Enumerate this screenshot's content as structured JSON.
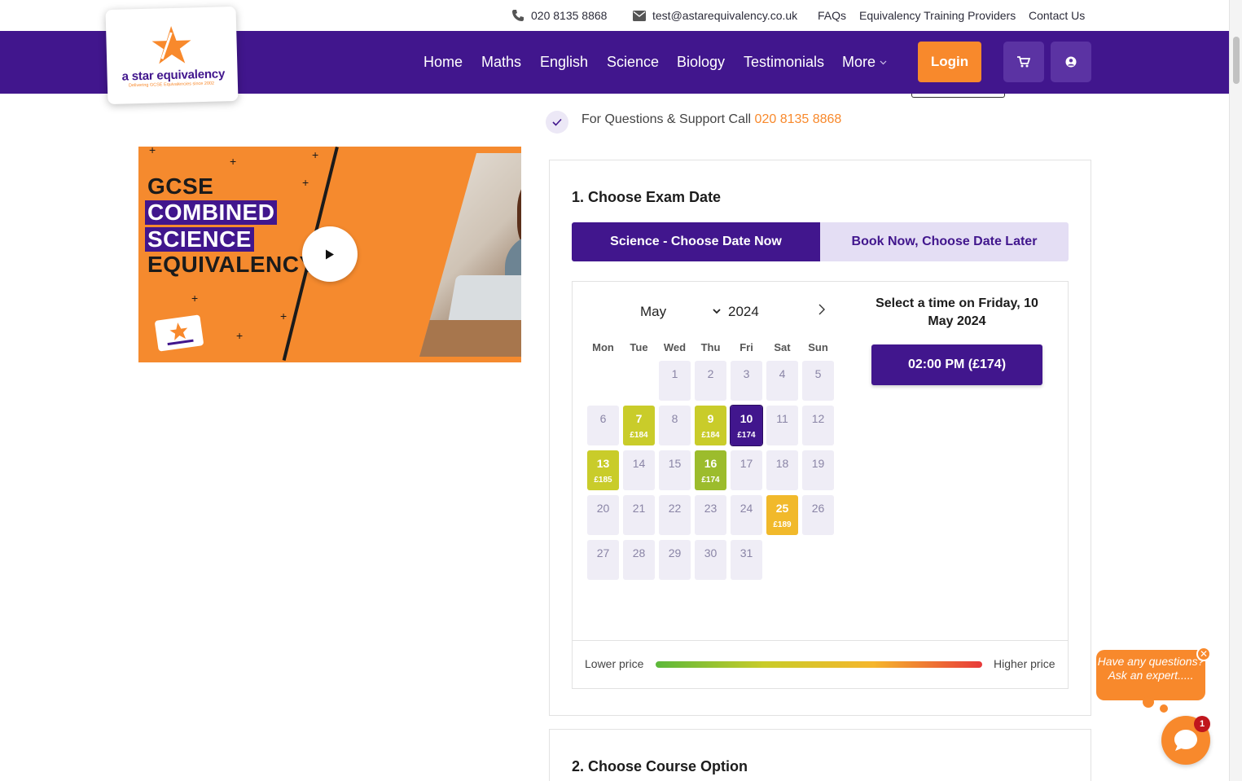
{
  "topbar": {
    "phone": "020 8135 8868",
    "email": "test@astarequivalency.co.uk",
    "links": [
      "FAQs",
      "Equivalency Training Providers",
      "Contact Us"
    ]
  },
  "brand": {
    "name": "a star equivalency",
    "tagline": "Delivering GCSE Equivalencies since 2002"
  },
  "nav": {
    "items": [
      "Home",
      "Maths",
      "English",
      "Science",
      "Biology",
      "Testimonials",
      "More"
    ],
    "login_label": "Login"
  },
  "support": {
    "text": "For Questions & Support Call ",
    "phone": "020 8135 8868"
  },
  "video": {
    "lines": [
      "GCSE",
      "COMBINED",
      "SCIENCE",
      "EQUIVALENCY"
    ]
  },
  "booking": {
    "step1_title": "1. Choose Exam Date",
    "tabs": [
      "Science - Choose Date Now",
      "Book Now, Choose Date Later"
    ],
    "calendar": {
      "month": "May",
      "year": "2024",
      "weekdays": [
        "Mon",
        "Tue",
        "Wed",
        "Thu",
        "Fri",
        "Sat",
        "Sun"
      ],
      "days": [
        {
          "d": "1",
          "col": 2,
          "row": 0
        },
        {
          "d": "2",
          "col": 3,
          "row": 0
        },
        {
          "d": "3",
          "col": 4,
          "row": 0
        },
        {
          "d": "4",
          "col": 5,
          "row": 0
        },
        {
          "d": "5",
          "col": 6,
          "row": 0
        },
        {
          "d": "6",
          "col": 0,
          "row": 1
        },
        {
          "d": "7",
          "col": 1,
          "row": 1,
          "price": "£184",
          "color": "#c9cc2a"
        },
        {
          "d": "8",
          "col": 2,
          "row": 1
        },
        {
          "d": "9",
          "col": 3,
          "row": 1,
          "price": "£184",
          "color": "#c9cc2a"
        },
        {
          "d": "10",
          "col": 4,
          "row": 1,
          "price": "£174",
          "selected": true
        },
        {
          "d": "11",
          "col": 5,
          "row": 1
        },
        {
          "d": "12",
          "col": 6,
          "row": 1
        },
        {
          "d": "13",
          "col": 0,
          "row": 2,
          "price": "£185",
          "color": "#c9cc2a"
        },
        {
          "d": "14",
          "col": 1,
          "row": 2
        },
        {
          "d": "15",
          "col": 2,
          "row": 2
        },
        {
          "d": "16",
          "col": 3,
          "row": 2,
          "price": "£174",
          "color": "#9cbc2c"
        },
        {
          "d": "17",
          "col": 4,
          "row": 2
        },
        {
          "d": "18",
          "col": 5,
          "row": 2
        },
        {
          "d": "19",
          "col": 6,
          "row": 2
        },
        {
          "d": "20",
          "col": 0,
          "row": 3
        },
        {
          "d": "21",
          "col": 1,
          "row": 3
        },
        {
          "d": "22",
          "col": 2,
          "row": 3
        },
        {
          "d": "23",
          "col": 3,
          "row": 3
        },
        {
          "d": "24",
          "col": 4,
          "row": 3
        },
        {
          "d": "25",
          "col": 5,
          "row": 3,
          "price": "£189",
          "color": "#f1b92b"
        },
        {
          "d": "26",
          "col": 6,
          "row": 3
        },
        {
          "d": "27",
          "col": 0,
          "row": 4
        },
        {
          "d": "28",
          "col": 1,
          "row": 4
        },
        {
          "d": "29",
          "col": 2,
          "row": 4
        },
        {
          "d": "30",
          "col": 3,
          "row": 4
        },
        {
          "d": "31",
          "col": 4,
          "row": 4
        }
      ]
    },
    "time_title": "Select a time on Friday, 10 May 2024",
    "time_slot": "02:00 PM (£174)",
    "legend": {
      "low": "Lower price",
      "high": "Higher price",
      "gradient": [
        "#5cb83a",
        "#c9cc2a",
        "#f5b62c",
        "#e83a3a"
      ]
    },
    "step2_title": "2. Choose Course Option"
  },
  "chat": {
    "prompt": "Have any questions? Ask an expert.....",
    "close": "✕",
    "badge": "1"
  },
  "colors": {
    "brand_purple": "#41168d",
    "brand_orange": "#f8892c"
  }
}
